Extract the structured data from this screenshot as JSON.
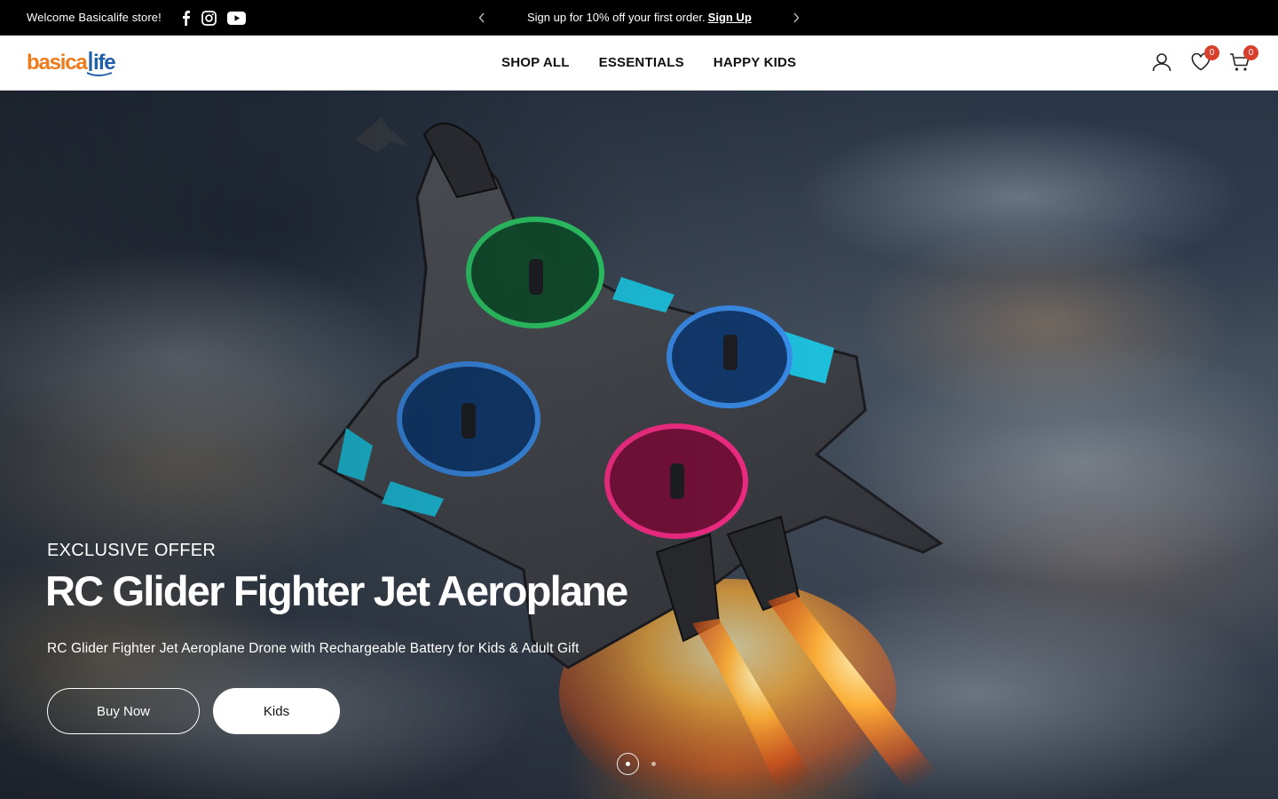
{
  "topbar": {
    "welcome": "Welcome Basicalife store!",
    "promo_text": "Sign up for 10% off your first order.",
    "promo_link": "Sign Up",
    "social": [
      "facebook-icon",
      "instagram-icon",
      "youtube-icon"
    ]
  },
  "header": {
    "logo_text": "basicalife",
    "nav": [
      "SHOP ALL",
      "ESSENTIALS",
      "HAPPY KIDS"
    ],
    "wishlist_count": "0",
    "cart_count": "0"
  },
  "hero": {
    "eyebrow": "EXCLUSIVE OFFER",
    "title": "RC Glider Fighter Jet Aeroplane",
    "description": "RC Glider Fighter Jet Aeroplane Drone with Rechargeable Battery for Kids & Adult Gift",
    "buttons": [
      "Buy Now",
      "Kids"
    ],
    "slides_total": 2,
    "active_slide": 1
  },
  "colors": {
    "topbar_bg": "#000000",
    "badge": "#d8402b",
    "logo_orange": "#f07a1a",
    "logo_blue": "#1f5fa8"
  }
}
